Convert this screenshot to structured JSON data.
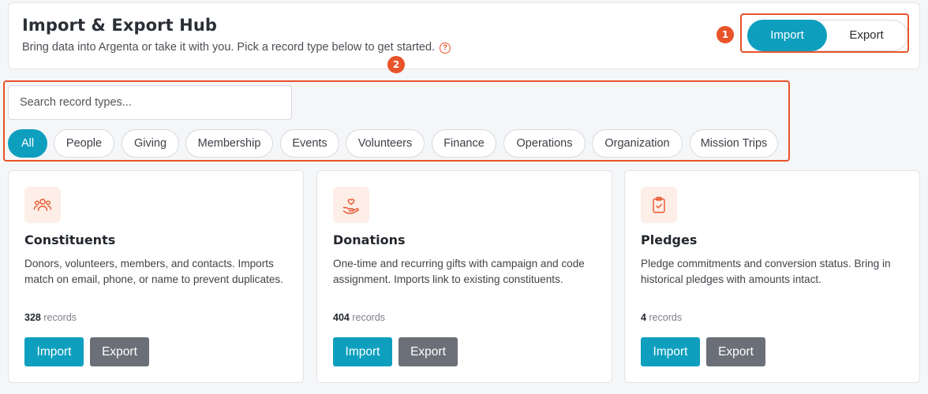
{
  "header": {
    "title": "Import & Export Hub",
    "subtitle": "Bring data into Argenta or take it with you. Pick a record type below to get started.",
    "help_glyph": "?",
    "mode_toggle": {
      "import_label": "Import",
      "export_label": "Export",
      "selected": "Import"
    }
  },
  "callouts": {
    "one": "1",
    "two": "2"
  },
  "search": {
    "placeholder": "Search record types...",
    "value": ""
  },
  "filters": {
    "selected": "All",
    "items": [
      "All",
      "People",
      "Giving",
      "Membership",
      "Events",
      "Volunteers",
      "Finance",
      "Operations",
      "Organization",
      "Mission Trips"
    ]
  },
  "cards": [
    {
      "title": "Constituents",
      "icon": "people-group-icon",
      "description": "Donors, volunteers, members, and contacts. Imports match on email, phone, or name to prevent duplicates.",
      "count": "328",
      "count_unit": "records",
      "import_label": "Import",
      "export_label": "Export"
    },
    {
      "title": "Donations",
      "icon": "hand-heart-icon",
      "description": "One-time and recurring gifts with campaign and code assignment. Imports link to existing constituents.",
      "count": "404",
      "count_unit": "records",
      "import_label": "Import",
      "export_label": "Export"
    },
    {
      "title": "Pledges",
      "icon": "clipboard-check-icon",
      "description": "Pledge commitments and conversion status. Bring in historical pledges with amounts intact.",
      "count": "4",
      "count_unit": "records",
      "import_label": "Import",
      "export_label": "Export"
    }
  ],
  "colors": {
    "accent": "#0e9fbf",
    "callout": "#e8532a",
    "secondary_button": "#6b7078",
    "icon_tile": "#fdeee7"
  }
}
